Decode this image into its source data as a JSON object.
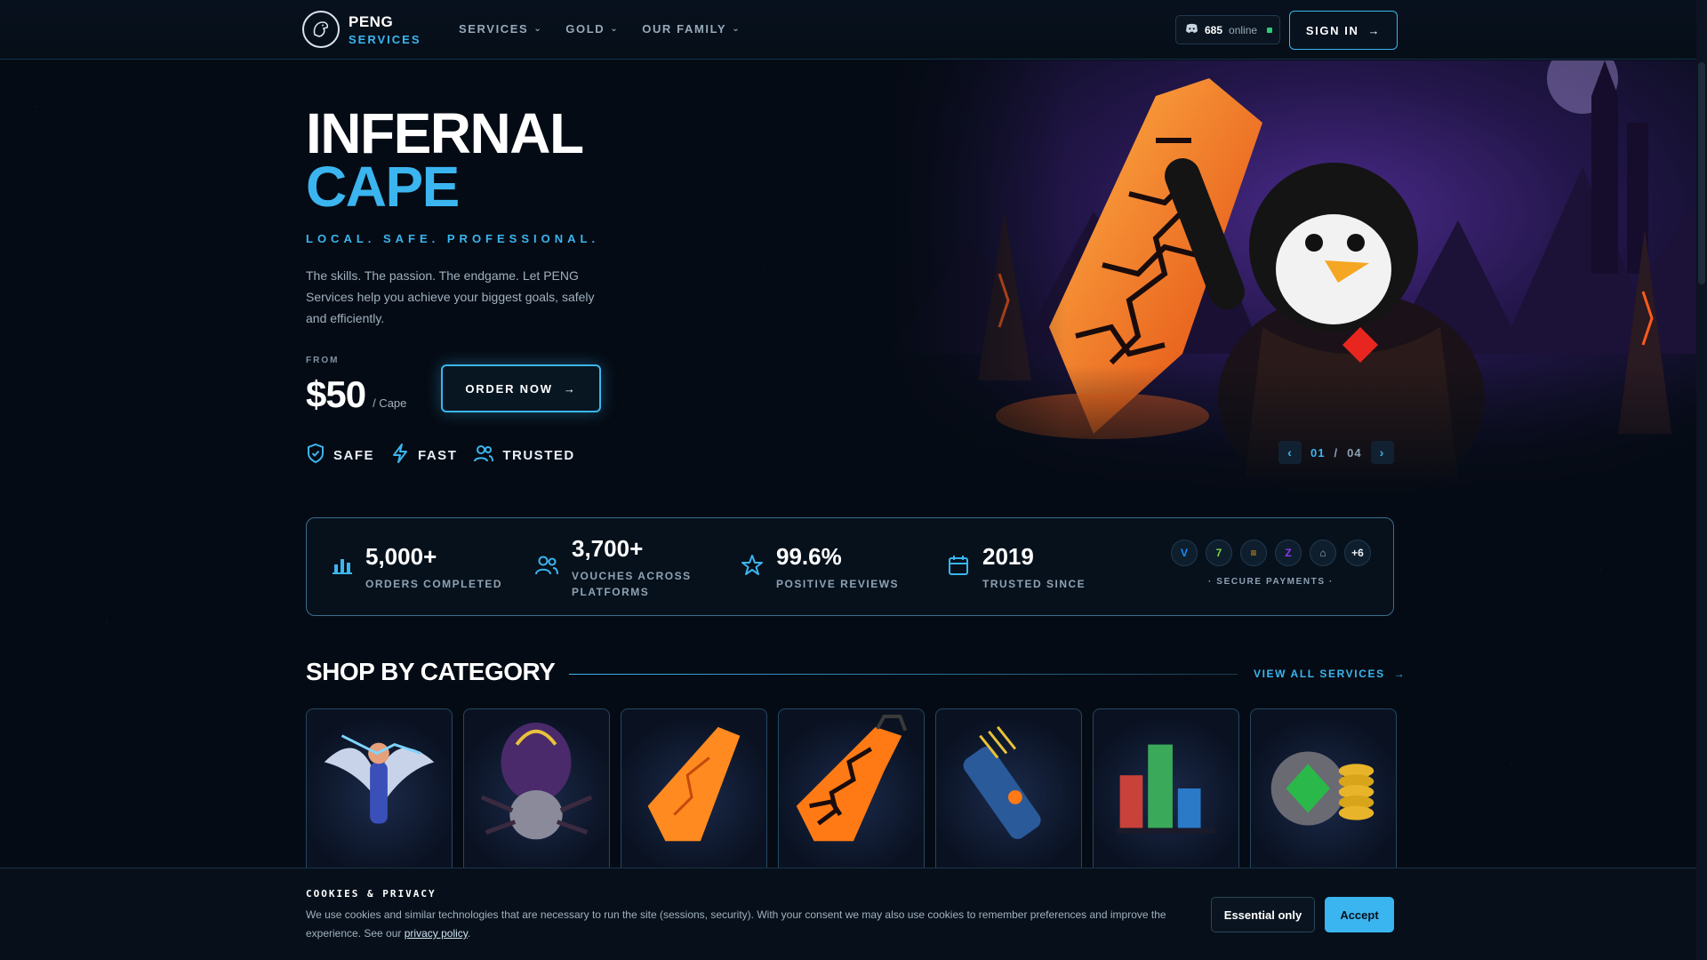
{
  "nav": {
    "logo_line1": "PENG",
    "logo_line2": "SERVICES",
    "menu": [
      {
        "label": "SERVICES"
      },
      {
        "label": "GOLD"
      },
      {
        "label": "OUR FAMILY"
      }
    ],
    "online_count": "685",
    "online_label": "online",
    "signin_label": "SIGN IN"
  },
  "hero": {
    "title_line1": "INFERNAL",
    "title_line2": "CAPE",
    "tagline": "LOCAL. SAFE. PROFESSIONAL.",
    "description": "The skills. The passion. The endgame. Let PENG Services help you achieve your biggest goals, safely and efficiently.",
    "from_label": "FROM",
    "price": "$50",
    "price_unit": "/ Cape",
    "order_label": "ORDER NOW",
    "badges": [
      {
        "label": "SAFE",
        "icon": "shield-icon"
      },
      {
        "label": "FAST",
        "icon": "lightning-icon"
      },
      {
        "label": "TRUSTED",
        "icon": "users-icon"
      }
    ],
    "slide_current": "01",
    "slide_sep": "/",
    "slide_total": "04"
  },
  "stats": [
    {
      "value": "5,000+",
      "label": "ORDERS COMPLETED",
      "icon": "bar-chart-icon"
    },
    {
      "value": "3,700+",
      "label": "VOUCHES ACROSS PLATFORMS",
      "icon": "users-icon"
    },
    {
      "value": "99.6%",
      "label": "POSITIVE REVIEWS",
      "icon": "star-icon"
    },
    {
      "value": "2019",
      "label": "TRUSTED SINCE",
      "icon": "calendar-icon"
    }
  ],
  "payments": {
    "label": "· SECURE PAYMENTS ·",
    "methods": [
      {
        "glyph": "V",
        "color": "#1a8cff"
      },
      {
        "glyph": "7",
        "color": "#78d64b"
      },
      {
        "glyph": "≡",
        "color": "#e8a21a"
      },
      {
        "glyph": "Z",
        "color": "#8a3cf0"
      },
      {
        "glyph": "⌂",
        "color": "#9fb0bf"
      },
      {
        "glyph": "+6",
        "color": "#e8eef5"
      }
    ]
  },
  "shop": {
    "title": "SHOP BY CATEGORY",
    "view_all": "VIEW ALL SERVICES"
  },
  "cookie": {
    "title": "COOKIES & PRIVACY",
    "text": "We use cookies and similar technologies that are necessary to run the site (sessions, security). With your consent we may also use cookies to remember preferences and improve the experience. See our",
    "link": "privacy policy",
    "text_end": ".",
    "essential_label": "Essential only",
    "accept_label": "Accept"
  },
  "colors": {
    "accent": "#3bb5ef",
    "background": "#050b14"
  }
}
